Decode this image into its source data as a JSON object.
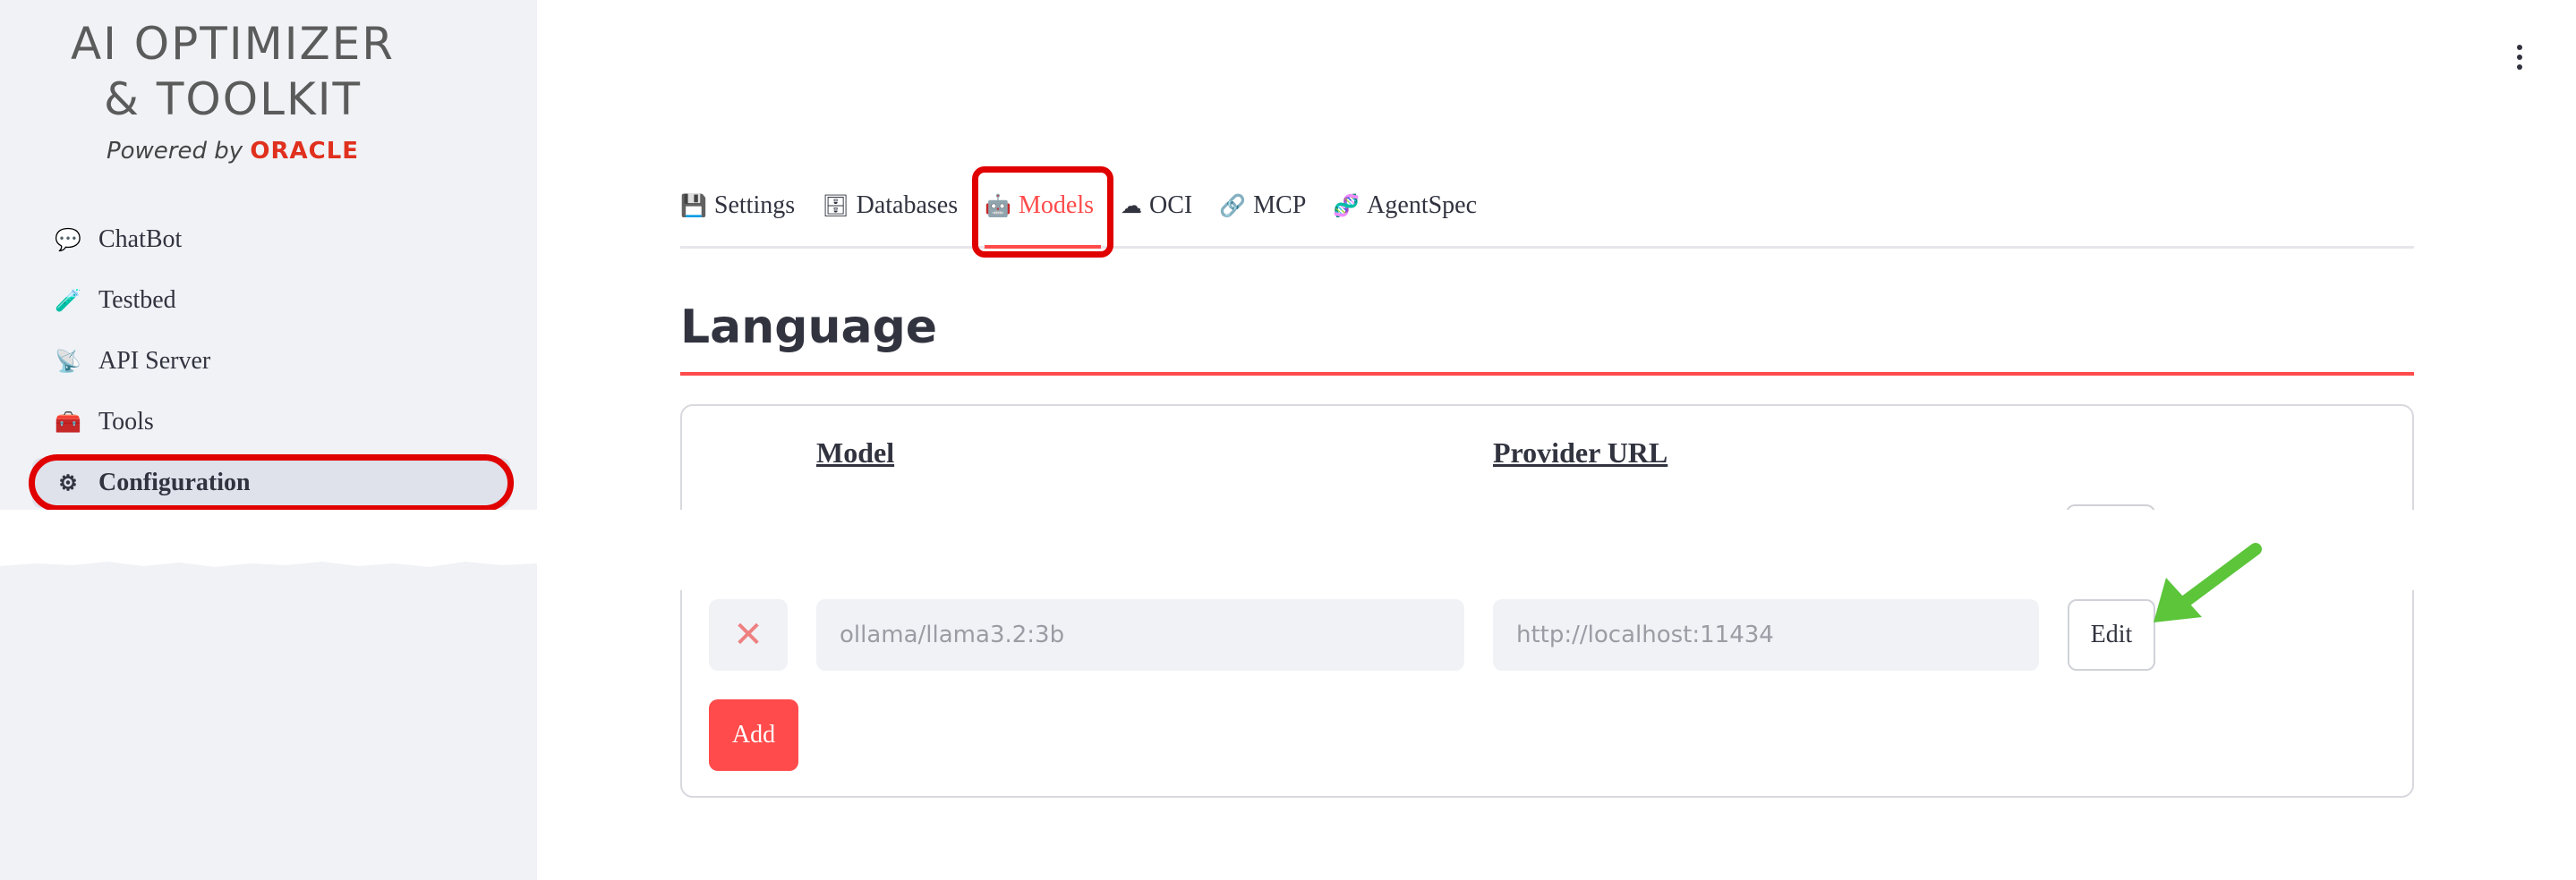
{
  "sidebar": {
    "logo_line1": "AI OPTIMIZER",
    "logo_line2": "& TOOLKIT",
    "powered_by": "Powered by ",
    "oracle": "ORACLE",
    "items": [
      {
        "label": "ChatBot",
        "icon": "speech-bubble-icon",
        "glyph": "💬"
      },
      {
        "label": "Testbed",
        "icon": "test-tube-icon",
        "glyph": "🧪"
      },
      {
        "label": "API Server",
        "icon": "satellite-icon",
        "glyph": "📡"
      },
      {
        "label": "Tools",
        "icon": "toolbox-icon",
        "glyph": "🧰"
      },
      {
        "label": "Configuration",
        "icon": "gear-icon",
        "glyph": "⚙"
      }
    ],
    "active_index": 4
  },
  "tabs": [
    {
      "label": "Settings",
      "icon": "floppy-disk-icon",
      "glyph": "💾"
    },
    {
      "label": "Databases",
      "icon": "file-cabinet-icon",
      "glyph": "🗄"
    },
    {
      "label": "Models",
      "icon": "robot-icon",
      "glyph": "🤖"
    },
    {
      "label": "OCI",
      "icon": "cloud-icon",
      "glyph": "☁"
    },
    {
      "label": "MCP",
      "icon": "link-icon",
      "glyph": "🔗"
    },
    {
      "label": "AgentSpec",
      "icon": "dna-icon",
      "glyph": "🧬"
    }
  ],
  "active_tab": "Models",
  "section": {
    "title": "Language",
    "col_model": "Model",
    "col_url": "Provider URL",
    "row": {
      "delete_glyph": "✕",
      "model": "ollama/llama3.2:3b",
      "url": "http://localhost:11434",
      "edit_label": "Edit"
    },
    "add_label": "Add"
  },
  "colors": {
    "accent": "#ff4b4b",
    "annotation_red": "#e00000",
    "annotation_green": "#5cc53a",
    "sidebar_bg": "#f0f2f6"
  }
}
